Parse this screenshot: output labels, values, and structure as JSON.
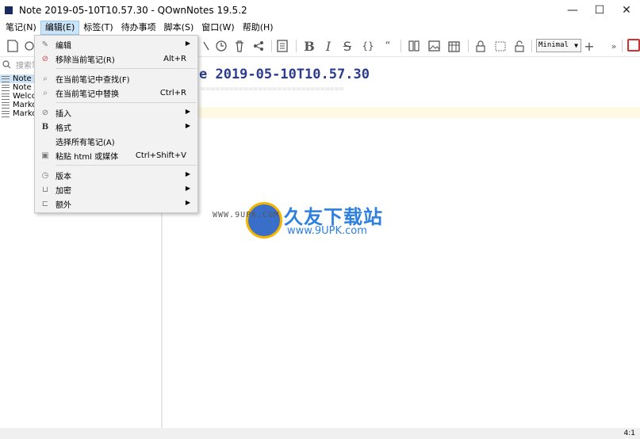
{
  "window": {
    "title": "Note 2019-05-10T10.57.30 - QOwnNotes 19.5.2",
    "minimize": "—",
    "maximize": "☐",
    "close": "✕"
  },
  "menubar": [
    {
      "label": "笔记(N)"
    },
    {
      "label": "编辑(E)"
    },
    {
      "label": "标签(T)"
    },
    {
      "label": "待办事项"
    },
    {
      "label": "脚本(S)"
    },
    {
      "label": "窗口(W)"
    },
    {
      "label": "帮助(H)"
    }
  ],
  "toolbar": {
    "icons": [
      "new-note-icon",
      "search-icon",
      "zoom-icon",
      "history-icon",
      "trash-icon",
      "share-icon",
      "list-icon",
      "bold-icon",
      "italic-icon",
      "strikethrough-icon",
      "code-block-icon",
      "quote-icon",
      "split-view-icon",
      "image-icon",
      "table-icon",
      "lock-icon",
      "encrypted-icon",
      "unlock-icon",
      "add-icon",
      "more-icon",
      "close-panel-icon"
    ],
    "bold": "B",
    "italic": "I",
    "strike": "S",
    "braces": "{}",
    "quote": "“",
    "add": "+",
    "more": "»",
    "workspace_select": "Minimal"
  },
  "search": {
    "placeholder": "搜索笔"
  },
  "notes": [
    {
      "label": "Note",
      "selected": true
    },
    {
      "label": "Note",
      "selected": false
    },
    {
      "label": "Welco",
      "selected": false
    },
    {
      "label": "Marko",
      "selected": false
    },
    {
      "label": "Marko",
      "selected": false
    }
  ],
  "editor": {
    "title_visible": "e 2019-05-10T10.57.30",
    "rule": "=============================="
  },
  "edit_menu": {
    "items": [
      {
        "label": "编辑",
        "shortcut": "",
        "icon": "pencil-icon",
        "submenu": true
      },
      {
        "label": "移除当前笔记(R)",
        "shortcut": "Alt+R",
        "icon": "remove-icon",
        "submenu": false
      },
      {
        "label": "在当前笔记中查找(F)",
        "shortcut": "",
        "icon": "find-icon",
        "submenu": false
      },
      {
        "label": "在当前笔记中替换",
        "shortcut": "Ctrl+R",
        "icon": "replace-icon",
        "submenu": false
      },
      {
        "label": "插入",
        "shortcut": "",
        "icon": "clip-icon",
        "submenu": true
      },
      {
        "label": "格式",
        "shortcut": "",
        "icon": "bold-icon",
        "submenu": true
      },
      {
        "label": "选择所有笔记(A)",
        "shortcut": "",
        "icon": "",
        "submenu": false
      },
      {
        "label": "粘贴 html 或媒体",
        "shortcut": "Ctrl+Shift+V",
        "icon": "image-icon",
        "submenu": false
      },
      {
        "label": "版本",
        "shortcut": "",
        "icon": "history-icon",
        "submenu": true
      },
      {
        "label": "加密",
        "shortcut": "",
        "icon": "lock-icon",
        "submenu": true
      },
      {
        "label": "额外",
        "shortcut": "",
        "icon": "tree-icon",
        "submenu": true
      }
    ]
  },
  "watermark": {
    "url": "WWW.9UPK.COM",
    "cn": "久友下载站",
    "en": "www.9UPK.com"
  },
  "status": {
    "position": "4:1"
  }
}
